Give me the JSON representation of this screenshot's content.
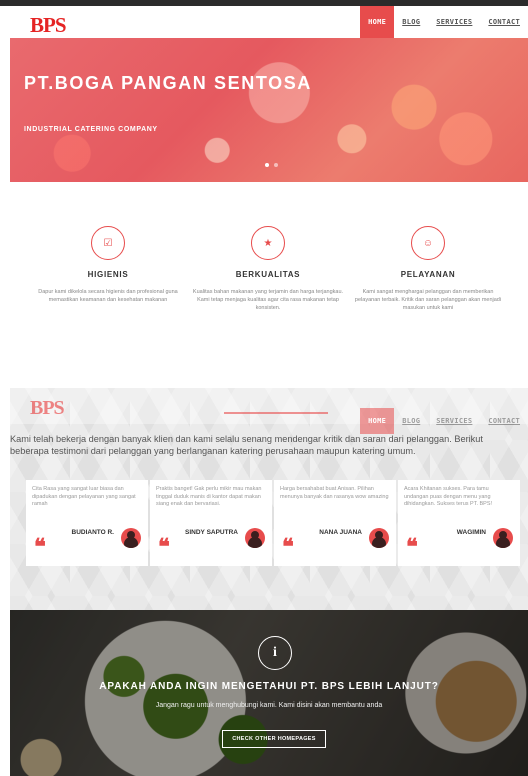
{
  "brand": {
    "logo": "BPS",
    "accent": "#e74c4c",
    "logo_color": "#e52424"
  },
  "nav": {
    "items": [
      "HOME",
      "BLOG",
      "SERVICES",
      "CONTACT"
    ],
    "active": "HOME"
  },
  "hero": {
    "title": "PT.BOGA PANGAN SENTOSA",
    "subtitle": "INDUSTRIAL CATERING COMPANY",
    "slide_count": 2,
    "active_slide": 1
  },
  "features": [
    {
      "icon": "check-square-icon",
      "glyph": "☑",
      "title": "HIGIENIS",
      "text": "Dapur kami dikelola secara higienis dan profesional guna memastikan keamanan dan kesehatan makanan"
    },
    {
      "icon": "star-icon",
      "glyph": "★",
      "title": "BERKUALITAS",
      "text": "Kualitas bahan makanan yang terjamin dan harga terjangkau. Kami tetap menjaga kualitas agar cita rasa makanan tetap konsisten."
    },
    {
      "icon": "smile-icon",
      "glyph": "☺",
      "title": "PELAYANAN",
      "text": "Kami sangat menghargai pelanggan dan memberikan pelayanan terbaik. Kritik dan saran pelanggan akan menjadi masukan untuk kami"
    }
  ],
  "testimonials": {
    "intro": "Kami telah bekerja dengan banyak klien dan kami selalu senang mendengar kritik dan saran dari pelanggan. Berikut beberapa testimoni dari pelanggan yang berlanganan katering perusahaan maupun katering umum.",
    "items": [
      {
        "text": "Cita Rasa yang sangat luar biasa dan dipadukan dengan pelayanan yang sangat ramah",
        "name": "BUDIANTO R."
      },
      {
        "text": "Praktis banget! Gak perlu mikir mau makan tinggal duduk manis di kantor dapat makan siang enak dan bervariasi.",
        "name": "SINDY SAPUTRA"
      },
      {
        "text": "Harga bersahabat buat Anisan. Pilihan menunya banyak dan rasanya wow amazing",
        "name": "NANA JUANA"
      },
      {
        "text": "Acara Khitanan sukses. Para tamu undangan puas dengan menu yang dihidangkan. Sukses terus PT. BPS!",
        "name": "WAGIMIN"
      }
    ]
  },
  "cta": {
    "icon": "info-icon",
    "glyph": "i",
    "title": "APAKAH ANDA INGIN MENGETAHUI PT. BPS LEBIH LANJUT?",
    "subtitle": "Jangan ragu untuk menghubungi kami. Kami disini akan membantu anda",
    "button": "CHECK OTHER HOMEPAGES"
  }
}
